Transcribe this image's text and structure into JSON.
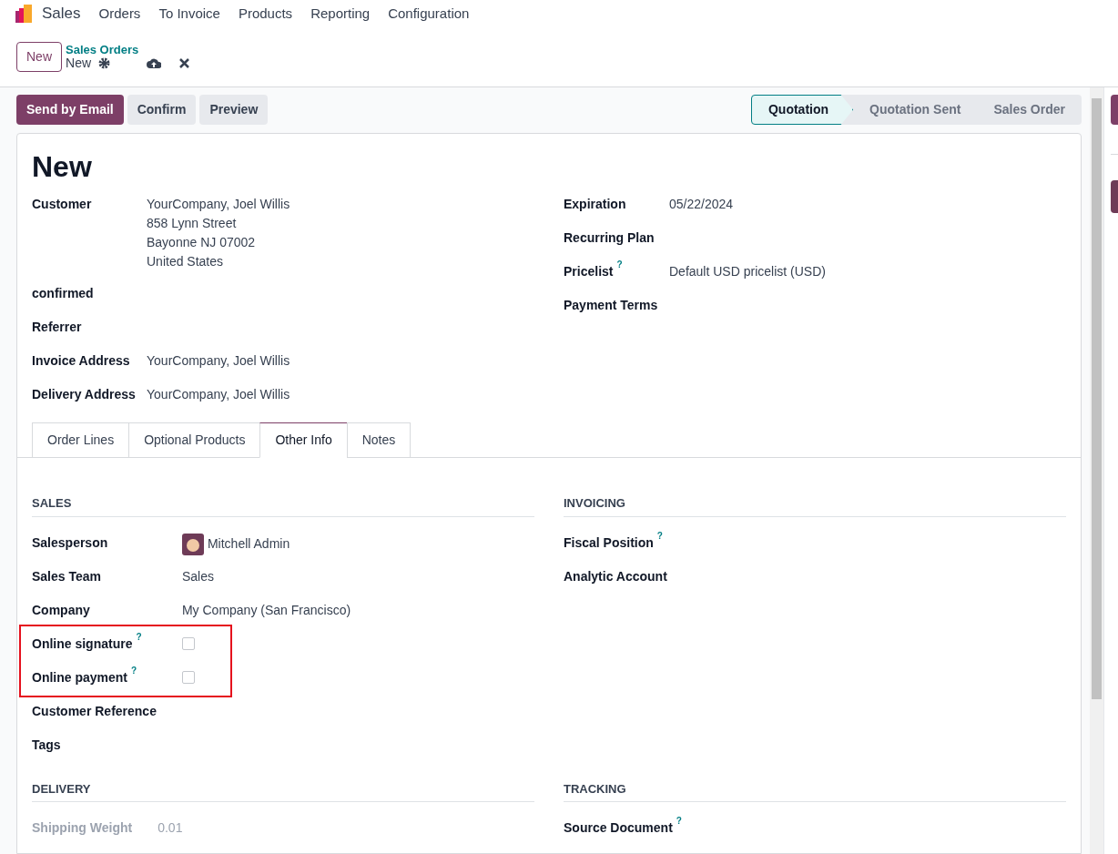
{
  "nav": {
    "app_name": "Sales",
    "menu": [
      "Orders",
      "To Invoice",
      "Products",
      "Reporting",
      "Configuration"
    ]
  },
  "control_panel": {
    "new_button": "New",
    "breadcrumb_parent": "Sales Orders",
    "breadcrumb_current": "New"
  },
  "actions": [
    {
      "label": "Send by Email",
      "kind": "primary"
    },
    {
      "label": "Confirm",
      "kind": "secondary"
    },
    {
      "label": "Preview",
      "kind": "secondary"
    }
  ],
  "stages": [
    {
      "label": "Quotation",
      "selected": true
    },
    {
      "label": "Quotation Sent",
      "selected": false
    },
    {
      "label": "Sales Order",
      "selected": false
    }
  ],
  "title": "New",
  "left_fields": [
    {
      "label": "Customer",
      "lines": [
        "YourCompany, Joel Willis",
        "858 Lynn Street",
        "Bayonne NJ 07002",
        "United States"
      ]
    },
    {
      "label": "confirmed"
    },
    {
      "label": "Referrer"
    },
    {
      "label": "Invoice Address",
      "lines": [
        "YourCompany, Joel Willis"
      ]
    },
    {
      "label": "Delivery Address",
      "lines": [
        "YourCompany, Joel Willis"
      ]
    }
  ],
  "right_fields": [
    {
      "label": "Expiration",
      "value": "05/22/2024"
    },
    {
      "label": "Recurring Plan"
    },
    {
      "label": "Pricelist",
      "help": "?",
      "value": "Default USD pricelist (USD)"
    },
    {
      "label": "Payment Terms"
    }
  ],
  "tabs": [
    {
      "label": "Order Lines",
      "selected": false
    },
    {
      "label": "Optional Products",
      "selected": false
    },
    {
      "label": "Other Info",
      "selected": true
    },
    {
      "label": "Notes",
      "selected": false
    }
  ],
  "sections": [
    {
      "title": "SALES",
      "fields": [
        {
          "label": "Salesperson",
          "kind": "avatar",
          "value": "Mitchell Admin"
        },
        {
          "label": "Sales Team",
          "kind": "text",
          "value": "Sales"
        },
        {
          "label": "Company",
          "kind": "text",
          "value": "My Company (San Francisco)"
        },
        {
          "label": "Online signature",
          "help": "?",
          "kind": "checkbox",
          "checked": false,
          "highlighted": true
        },
        {
          "label": "Online payment",
          "help": "?",
          "kind": "checkbox",
          "checked": false,
          "highlighted": true
        },
        {
          "label": "Customer Reference",
          "kind": "empty"
        },
        {
          "label": "Tags",
          "kind": "empty"
        }
      ]
    },
    {
      "title": "INVOICING",
      "fields": [
        {
          "label": "Fiscal Position",
          "help": "?",
          "kind": "empty"
        },
        {
          "label": "Analytic Account",
          "kind": "empty"
        }
      ]
    },
    {
      "title": "DELIVERY",
      "fields": [
        {
          "label": "Shipping Weight",
          "kind": "readonly",
          "value": "0.01"
        }
      ]
    },
    {
      "title": "TRACKING",
      "fields": [
        {
          "label": "Source Document",
          "help": "?",
          "kind": "empty"
        }
      ]
    }
  ]
}
